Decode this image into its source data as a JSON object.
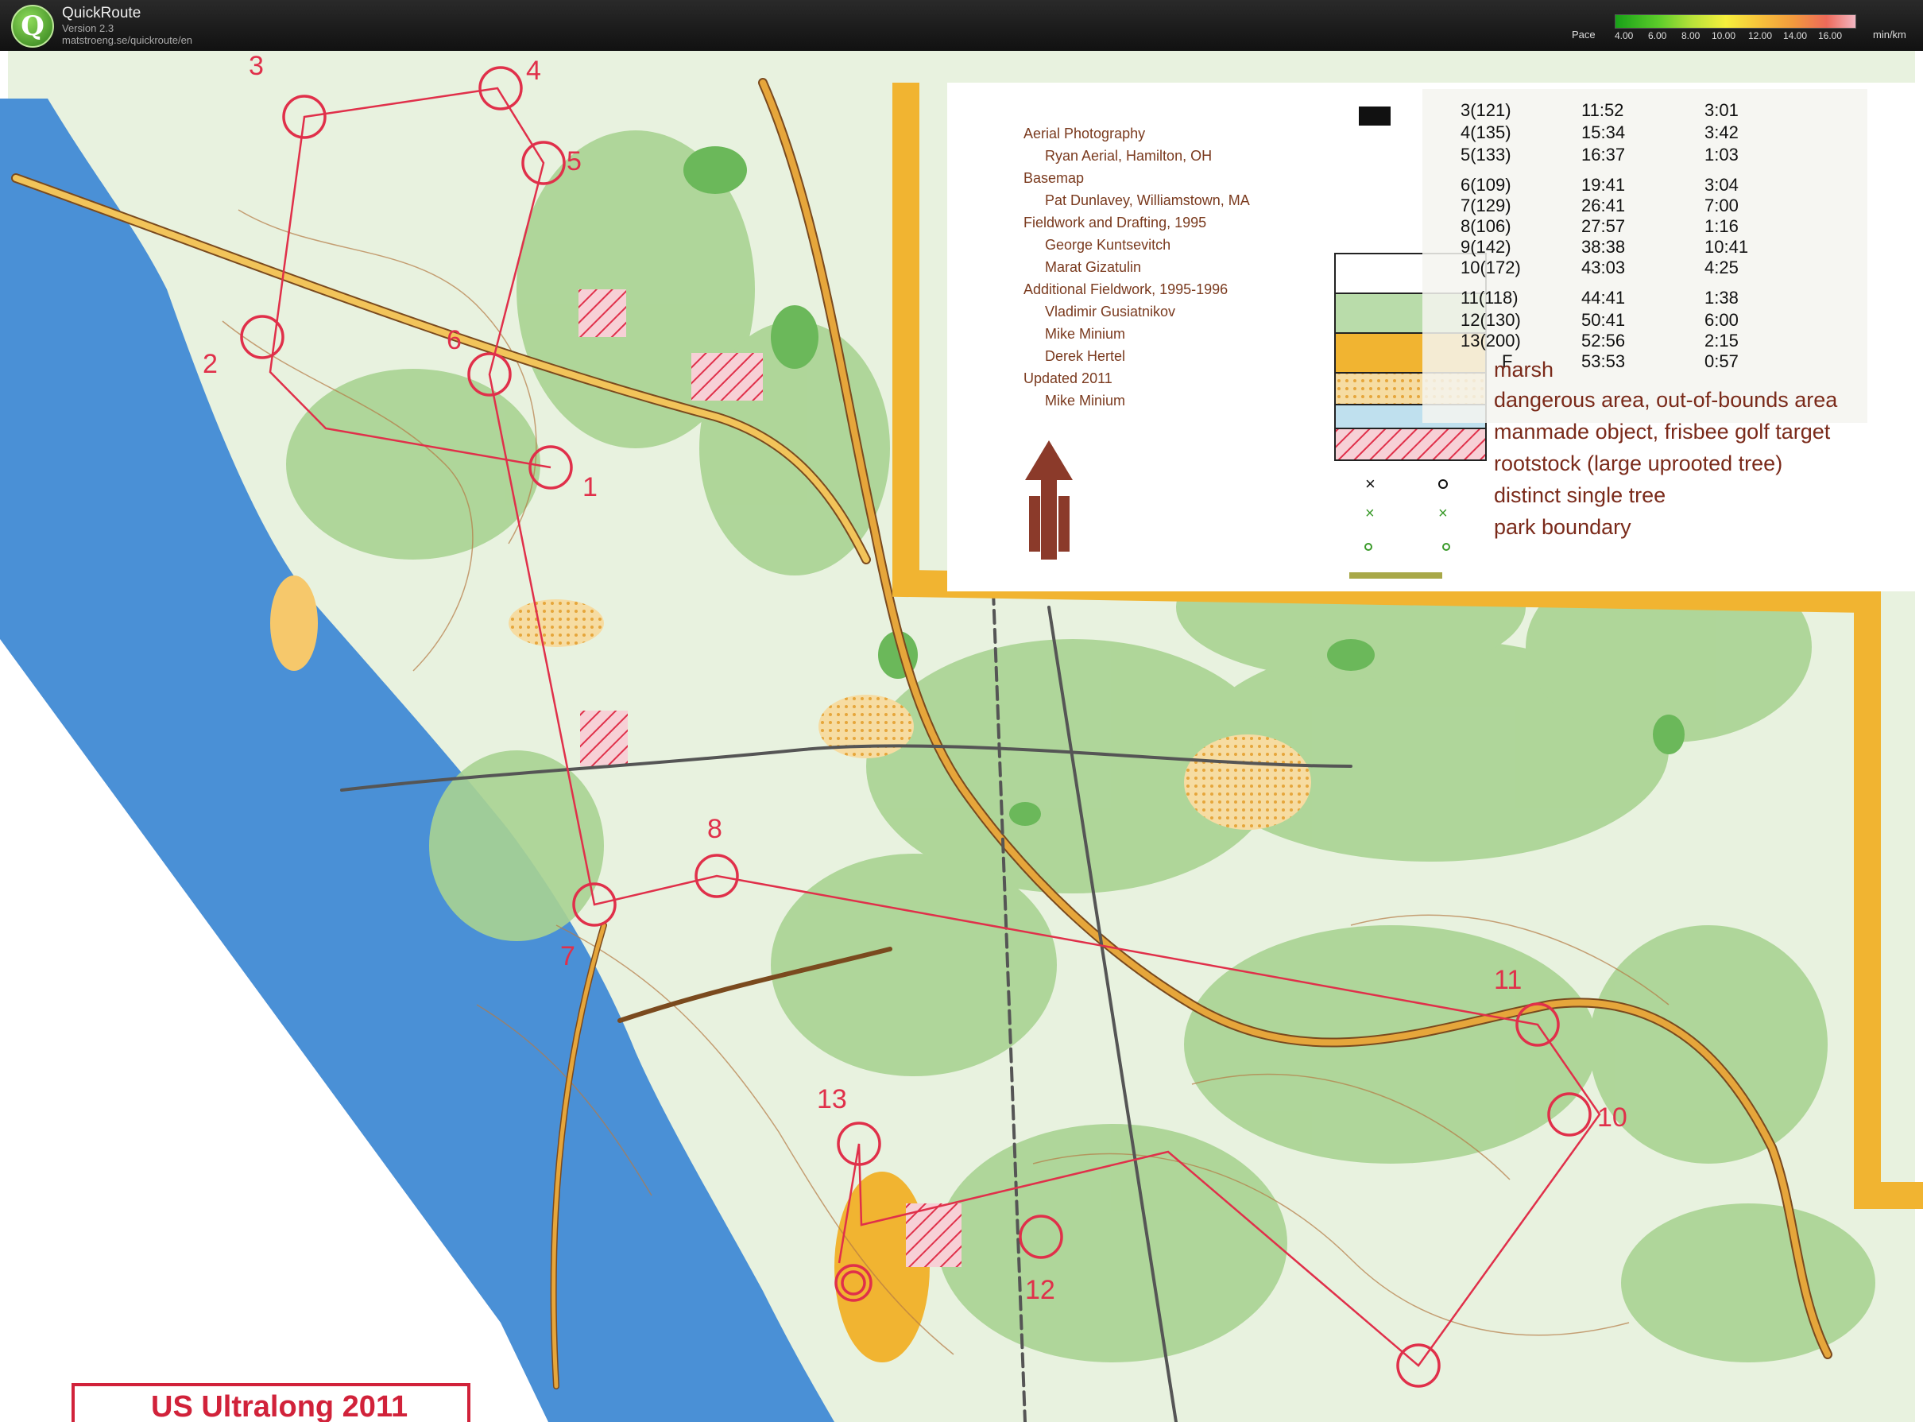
{
  "app": {
    "name": "QuickRoute",
    "version": "Version 2.3",
    "url": "matstroeng.se/quickroute/en",
    "icon": "quickroute-logo-icon"
  },
  "pace_scale": {
    "label": "Pace",
    "ticks": [
      "4.00",
      "6.00",
      "8.00",
      "10.00",
      "12.00",
      "14.00",
      "16.00"
    ],
    "unit": "min/km",
    "colors": [
      "#18a018",
      "#5ccd2a",
      "#b8e23a",
      "#f6ef3c",
      "#f7c23b",
      "#f29a3d",
      "#ee6a5a",
      "#f1b6c2"
    ]
  },
  "map": {
    "title": "US Ultralong 2011",
    "credits": [
      "Aerial Photography",
      "Ryan Aerial, Hamilton, OH",
      "Basemap",
      "Pat Dunlavey, Williamstown, MA",
      "Fieldwork and Drafting, 1995",
      "George Kuntsevitch",
      "Marat Gizatulin",
      "Additional Fieldwork, 1995-1996",
      "Vladimir Gusiatnikov",
      "Mike Minium",
      "Derek Hertel",
      "Updated 2011",
      "Mike Minium"
    ],
    "splits": [
      {
        "control": "3(121)",
        "time": "11:52",
        "leg": "3:01"
      },
      {
        "control": "4(135)",
        "time": "15:34",
        "leg": "3:42"
      },
      {
        "control": "5(133)",
        "time": "16:37",
        "leg": "1:03"
      },
      {
        "control": "6(109)",
        "time": "19:41",
        "leg": "3:04"
      },
      {
        "control": "7(129)",
        "time": "26:41",
        "leg": "7:00"
      },
      {
        "control": "8(106)",
        "time": "27:57",
        "leg": "1:16"
      },
      {
        "control": "9(142)",
        "time": "38:38",
        "leg": "10:41"
      },
      {
        "control": "10(172)",
        "time": "43:03",
        "leg": "4:25"
      },
      {
        "control": "11(118)",
        "time": "44:41",
        "leg": "1:38"
      },
      {
        "control": "12(130)",
        "time": "50:41",
        "leg": "6:00"
      },
      {
        "control": "13(200)",
        "time": "52:56",
        "leg": "2:15"
      },
      {
        "control": "F",
        "time": "53:53",
        "leg": "0:57"
      }
    ],
    "legend": [
      "marsh",
      "dangerous area, out-of-bounds area",
      "manmade object, frisbee golf target",
      "rootstock (large uprooted tree)",
      "distinct single tree",
      "park boundary"
    ],
    "controls": [
      "1",
      "2",
      "3",
      "4",
      "5",
      "6",
      "7",
      "8",
      "10",
      "11",
      "12",
      "13"
    ],
    "colors": {
      "course": "#e0304a",
      "water": "#4a90d6",
      "forest": "#b9dcaa",
      "road": "#e6a63b",
      "boundary": "#f1b431"
    }
  }
}
